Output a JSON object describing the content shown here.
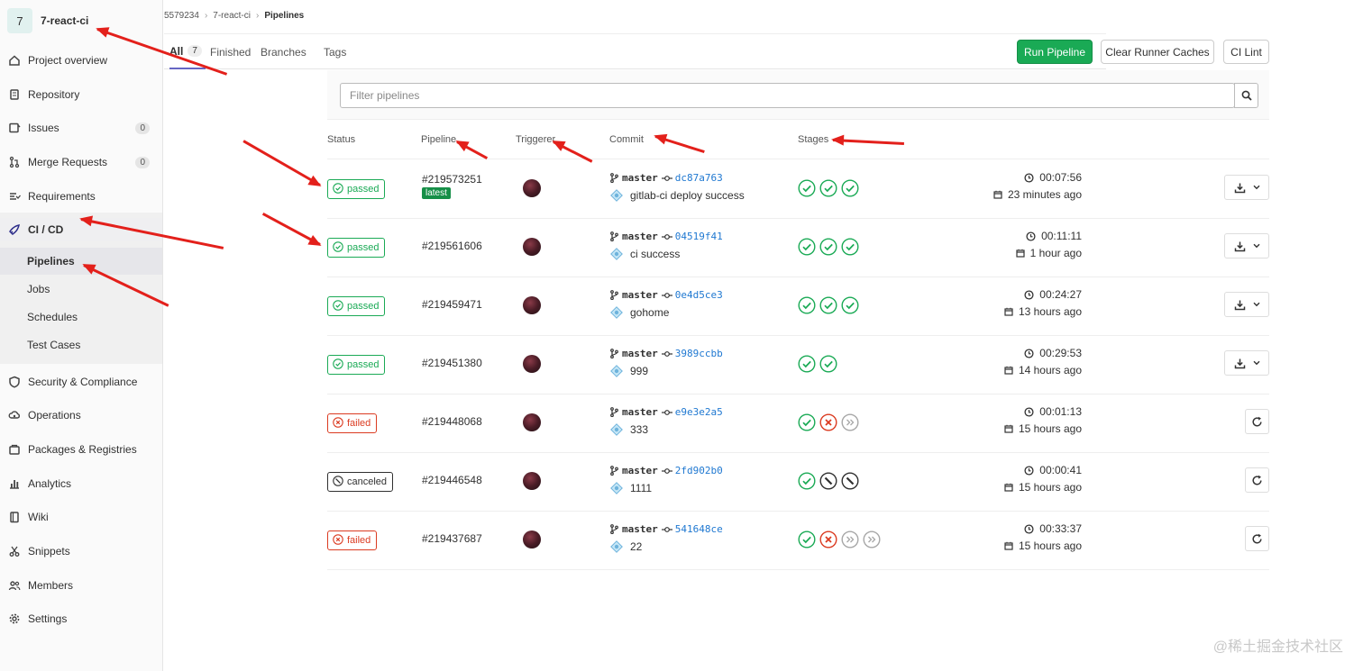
{
  "project": {
    "initial": "7",
    "name": "7-react-ci"
  },
  "sidebar": {
    "items": [
      {
        "label": "Project overview",
        "icon": "home-icon",
        "count": ""
      },
      {
        "label": "Repository",
        "icon": "repository-icon",
        "count": ""
      },
      {
        "label": "Issues",
        "icon": "issues-icon",
        "count": "0"
      },
      {
        "label": "Merge Requests",
        "icon": "merge-request-icon",
        "count": "0"
      },
      {
        "label": "Requirements",
        "icon": "requirements-icon",
        "count": ""
      },
      {
        "label": "CI / CD",
        "icon": "rocket-icon",
        "count": ""
      },
      {
        "label": "Security & Compliance",
        "icon": "shield-icon",
        "count": ""
      },
      {
        "label": "Operations",
        "icon": "cloud-gear-icon",
        "count": ""
      },
      {
        "label": "Packages & Registries",
        "icon": "package-icon",
        "count": ""
      },
      {
        "label": "Analytics",
        "icon": "chart-icon",
        "count": ""
      },
      {
        "label": "Wiki",
        "icon": "book-icon",
        "count": ""
      },
      {
        "label": "Snippets",
        "icon": "scissors-icon",
        "count": ""
      },
      {
        "label": "Members",
        "icon": "users-icon",
        "count": ""
      },
      {
        "label": "Settings",
        "icon": "gear-icon",
        "count": ""
      }
    ],
    "subitems": [
      {
        "label": "Pipelines"
      },
      {
        "label": "Jobs"
      },
      {
        "label": "Schedules"
      },
      {
        "label": "Test Cases"
      }
    ]
  },
  "breadcrumb": {
    "group": "5579234",
    "project": "7-react-ci",
    "page": "Pipelines"
  },
  "tabs": [
    {
      "label": "All",
      "count": "7"
    },
    {
      "label": "Finished",
      "count": ""
    },
    {
      "label": "Branches",
      "count": ""
    },
    {
      "label": "Tags",
      "count": ""
    }
  ],
  "buttons": {
    "run": "Run Pipeline",
    "clear": "Clear Runner Caches",
    "lint": "CI Lint"
  },
  "filter": {
    "placeholder": "Filter pipelines"
  },
  "columns": {
    "status": "Status",
    "pipeline": "Pipeline",
    "triggerer": "Triggerer",
    "commit": "Commit",
    "stages": "Stages"
  },
  "pipelines": [
    {
      "status": "passed",
      "id": "#219573251",
      "latest": "latest",
      "branch": "master",
      "sha": "dc87a763",
      "message": "gitlab-ci deploy success",
      "stages": [
        "success",
        "success",
        "success"
      ],
      "duration": "00:07:56",
      "finished": "23 minutes ago",
      "action": "download"
    },
    {
      "status": "passed",
      "id": "#219561606",
      "latest": "",
      "branch": "master",
      "sha": "04519f41",
      "message": "ci success",
      "stages": [
        "success",
        "success",
        "success"
      ],
      "duration": "00:11:11",
      "finished": "1 hour ago",
      "action": "download"
    },
    {
      "status": "passed",
      "id": "#219459471",
      "latest": "",
      "branch": "master",
      "sha": "0e4d5ce3",
      "message": "gohome",
      "stages": [
        "success",
        "success",
        "success"
      ],
      "duration": "00:24:27",
      "finished": "13 hours ago",
      "action": "download"
    },
    {
      "status": "passed",
      "id": "#219451380",
      "latest": "",
      "branch": "master",
      "sha": "3989ccbb",
      "message": "999",
      "stages": [
        "success",
        "success"
      ],
      "duration": "00:29:53",
      "finished": "14 hours ago",
      "action": "download"
    },
    {
      "status": "failed",
      "id": "#219448068",
      "latest": "",
      "branch": "master",
      "sha": "e9e3e2a5",
      "message": "333",
      "stages": [
        "success",
        "failed",
        "skipped"
      ],
      "duration": "00:01:13",
      "finished": "15 hours ago",
      "action": "retry"
    },
    {
      "status": "canceled",
      "id": "#219446548",
      "latest": "",
      "branch": "master",
      "sha": "2fd902b0",
      "message": "1111",
      "stages": [
        "success",
        "canceled",
        "canceled"
      ],
      "duration": "00:00:41",
      "finished": "15 hours ago",
      "action": "retry"
    },
    {
      "status": "failed",
      "id": "#219437687",
      "latest": "",
      "branch": "master",
      "sha": "541648ce",
      "message": "22",
      "stages": [
        "success",
        "failed",
        "skipped",
        "skipped"
      ],
      "duration": "00:33:37",
      "finished": "15 hours ago",
      "action": "retry"
    }
  ],
  "colors": {
    "success": "#1aaa55",
    "failed": "#db3b21",
    "canceled": "#303030",
    "skipped": "#a7a7a7",
    "primary_button": "#1aaa55",
    "link": "#1f78d1",
    "annotation_arrow": "#e3201b"
  },
  "watermark": "@稀土掘金技术社区"
}
